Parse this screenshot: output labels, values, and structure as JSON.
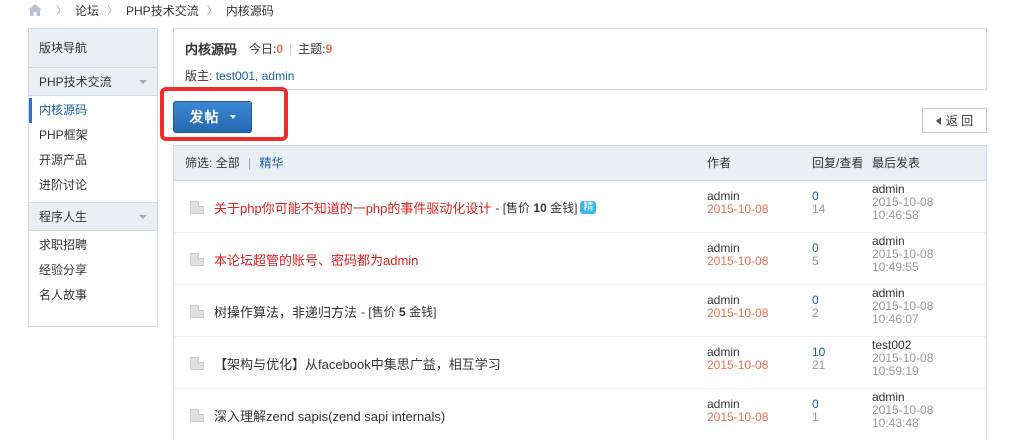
{
  "breadcrumb": {
    "items": [
      "论坛",
      "PHP技术交流",
      "内核源码"
    ]
  },
  "sidebar": {
    "header": "版块导航",
    "groups": [
      {
        "label": "PHP技术交流",
        "items": [
          "内核源码",
          "PHP框架",
          "开源产品",
          "进阶讨论"
        ]
      },
      {
        "label": "程序人生",
        "items": [
          "求职招聘",
          "经验分享",
          "名人故事"
        ]
      }
    ]
  },
  "forum": {
    "title": "内核源码",
    "today_label": "今日:",
    "today_value": "0",
    "topics_label": "主题:",
    "topics_value": "9",
    "moderators_label": "版主:",
    "moderators": "test001, admin"
  },
  "toolbar": {
    "post_label": "发帖",
    "back_label": "返 回"
  },
  "table": {
    "filter_label": "筛选:",
    "filter_all": "全部",
    "filter_digest": "精华",
    "col_author": "作者",
    "col_reply_view": "回复/查看",
    "col_last_post": "最后发表",
    "rows": [
      {
        "title": "关于php你可能不知道的一php的事件驱动化设计",
        "price_prefix": "- [售价",
        "price": "10",
        "price_suffix": "金钱]",
        "digest": "精",
        "author": "admin",
        "date": "2015-10-08",
        "replies": "0",
        "views": "14",
        "last_user": "admin",
        "last_date": "2015-10-08",
        "last_time": "10:46:58"
      },
      {
        "title": "本论坛超管的账号、密码都为admin",
        "price_prefix": "",
        "price": "",
        "price_suffix": "",
        "digest": "",
        "author": "admin",
        "date": "2015-10-08",
        "replies": "0",
        "views": "5",
        "last_user": "admin",
        "last_date": "2015-10-08",
        "last_time": "10:49:55"
      },
      {
        "title": "树操作算法，非递归方法",
        "price_prefix": "- [售价",
        "price": "5",
        "price_suffix": "金钱]",
        "digest": "",
        "author": "admin",
        "date": "2015-10-08",
        "replies": "0",
        "views": "2",
        "last_user": "admin",
        "last_date": "2015-10-08",
        "last_time": "10:46:07"
      },
      {
        "title": "【架构与优化】从facebook中集思广益，相互学习",
        "price_prefix": "",
        "price": "",
        "price_suffix": "",
        "digest": "",
        "author": "admin",
        "date": "2015-10-08",
        "replies": "10",
        "views": "21",
        "last_user": "test002",
        "last_date": "2015-10-08",
        "last_time": "10:59:19"
      },
      {
        "title": "深入理解zend sapis(zend sapi internals)",
        "price_prefix": "",
        "price": "",
        "price_suffix": "",
        "digest": "",
        "author": "admin",
        "date": "2015-10-08",
        "replies": "0",
        "views": "1",
        "last_user": "admin",
        "last_date": "2015-10-08",
        "last_time": "10:43:48"
      }
    ]
  },
  "colors": {
    "accent_blue": "#2b75c4",
    "highlight_red": "#ee2c2c",
    "hot_title_red": "#e31f1f",
    "date_orange": "#f26c4f"
  },
  "icons": {
    "home": "home-icon",
    "thread": "thread-file-icon"
  }
}
